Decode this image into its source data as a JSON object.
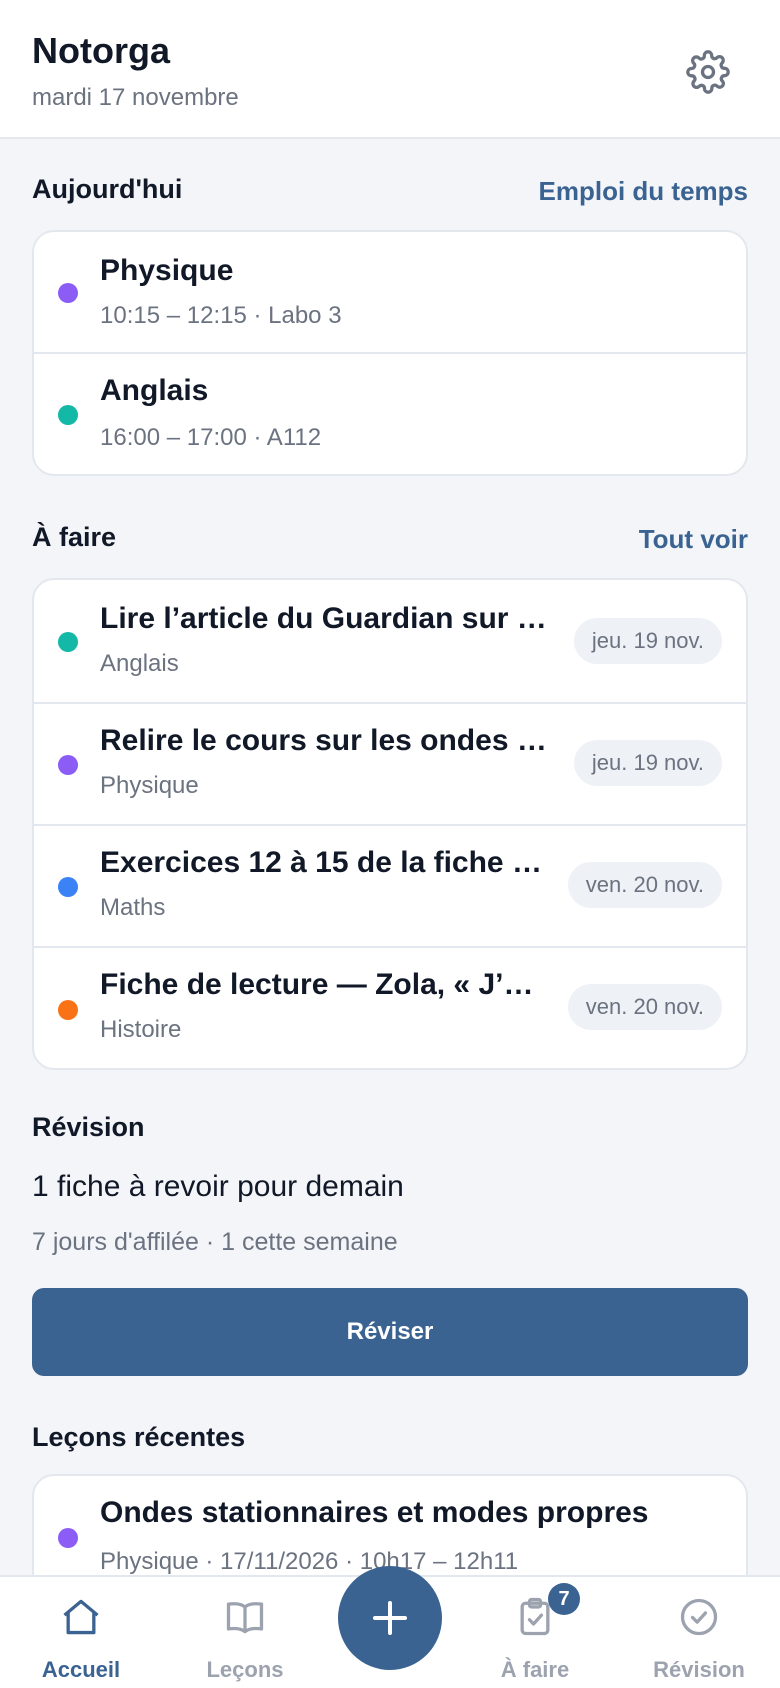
{
  "header": {
    "title": "Notorga",
    "date": "mardi 17 novembre",
    "settings_icon": "gear-icon"
  },
  "today": {
    "title": "Aujourd'hui",
    "link": "Emploi du temps",
    "items": [
      {
        "title": "Physique",
        "detail": "10:15 – 12:15 · Labo 3",
        "color": "#8b5cf6"
      },
      {
        "title": "Anglais",
        "detail": "16:00 – 17:00 · A112",
        "color": "#14b8a6"
      }
    ]
  },
  "todo": {
    "title": "À faire",
    "link": "Tout voir",
    "items": [
      {
        "title": "Lire l’article du Guardian sur …",
        "subject": "Anglais",
        "due": "jeu. 19 nov.",
        "color": "#14b8a6"
      },
      {
        "title": "Relire le cours sur les ondes …",
        "subject": "Physique",
        "due": "jeu. 19 nov.",
        "color": "#8b5cf6"
      },
      {
        "title": "Exercices 12 à 15 de la fiche …",
        "subject": "Maths",
        "due": "ven. 20 nov.",
        "color": "#3b82f6"
      },
      {
        "title": "Fiche de lecture — Zola, « J’…",
        "subject": "Histoire",
        "due": "ven. 20 nov.",
        "color": "#f97316"
      }
    ]
  },
  "revision": {
    "title": "Révision",
    "summary": "1 fiche à revoir pour demain",
    "stats": "7 jours d'affilée · 1 cette semaine",
    "button": "Réviser"
  },
  "recent": {
    "title": "Leçons récentes",
    "items": [
      {
        "title": "Ondes stationnaires et modes propres",
        "detail": "Physique · 17/11/2026 · 10h17 – 12h11",
        "color": "#8b5cf6"
      }
    ]
  },
  "nav": {
    "items": [
      {
        "label": "Accueil",
        "icon": "home-icon"
      },
      {
        "label": "Leçons",
        "icon": "book-icon"
      },
      {
        "label": "À faire",
        "icon": "clipboard-check-icon"
      },
      {
        "label": "Révision",
        "icon": "check-circle-icon"
      }
    ],
    "todo_badge": "7",
    "fab_icon": "plus-icon"
  },
  "colors": {
    "accent": "#3b6392",
    "physique": "#8b5cf6",
    "anglais": "#14b8a6",
    "maths": "#3b82f6",
    "histoire": "#f97316"
  }
}
